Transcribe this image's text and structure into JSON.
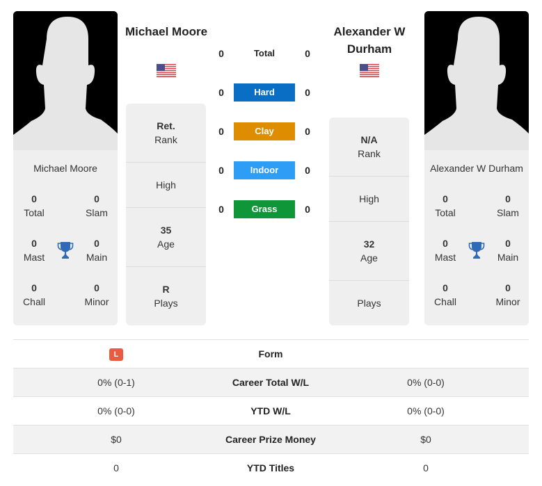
{
  "player1": {
    "heading": "Michael Moore",
    "card_name": "Michael Moore",
    "country_flag": "us-flag",
    "titles": {
      "total": {
        "value": "0",
        "label": "Total"
      },
      "slam": {
        "value": "0",
        "label": "Slam"
      },
      "mast": {
        "value": "0",
        "label": "Mast"
      },
      "main": {
        "value": "0",
        "label": "Main"
      },
      "chall": {
        "value": "0",
        "label": "Chall"
      },
      "minor": {
        "value": "0",
        "label": "Minor"
      }
    },
    "info": {
      "rank": {
        "value": "Ret.",
        "label": "Rank"
      },
      "high": {
        "value": "",
        "label": "High"
      },
      "age": {
        "value": "35",
        "label": "Age"
      },
      "plays": {
        "value": "R",
        "label": "Plays"
      }
    }
  },
  "player2": {
    "heading": "Alexander W Durham",
    "card_name": "Alexander W Durham",
    "country_flag": "us-flag",
    "titles": {
      "total": {
        "value": "0",
        "label": "Total"
      },
      "slam": {
        "value": "0",
        "label": "Slam"
      },
      "mast": {
        "value": "0",
        "label": "Mast"
      },
      "main": {
        "value": "0",
        "label": "Main"
      },
      "chall": {
        "value": "0",
        "label": "Chall"
      },
      "minor": {
        "value": "0",
        "label": "Minor"
      }
    },
    "info": {
      "rank": {
        "value": "N/A",
        "label": "Rank"
      },
      "high": {
        "value": "",
        "label": "High"
      },
      "age": {
        "value": "32",
        "label": "Age"
      },
      "plays": {
        "value": "",
        "label": "Plays"
      }
    }
  },
  "surfaces": [
    {
      "label": "Total",
      "p1": "0",
      "p2": "0",
      "color": ""
    },
    {
      "label": "Hard",
      "p1": "0",
      "p2": "0",
      "color": "#0a6fc4"
    },
    {
      "label": "Clay",
      "p1": "0",
      "p2": "0",
      "color": "#de8c00"
    },
    {
      "label": "Indoor",
      "p1": "0",
      "p2": "0",
      "color": "#2d9df5"
    },
    {
      "label": "Grass",
      "p1": "0",
      "p2": "0",
      "color": "#0f9639"
    }
  ],
  "comparison": {
    "form": {
      "label": "Form",
      "p1_badges": [
        "L"
      ],
      "p1_badge_color": "#e95c3f"
    },
    "rows": [
      {
        "label": "Career Total W/L",
        "p1": "0% (0-1)",
        "p2": "0% (0-0)"
      },
      {
        "label": "YTD W/L",
        "p1": "0% (0-0)",
        "p2": "0% (0-0)"
      },
      {
        "label": "Career Prize Money",
        "p1": "$0",
        "p2": "$0"
      },
      {
        "label": "YTD Titles",
        "p1": "0",
        "p2": "0"
      }
    ]
  },
  "colors": {
    "trophy": "#2f6ab7",
    "card_bg": "#efefef"
  }
}
